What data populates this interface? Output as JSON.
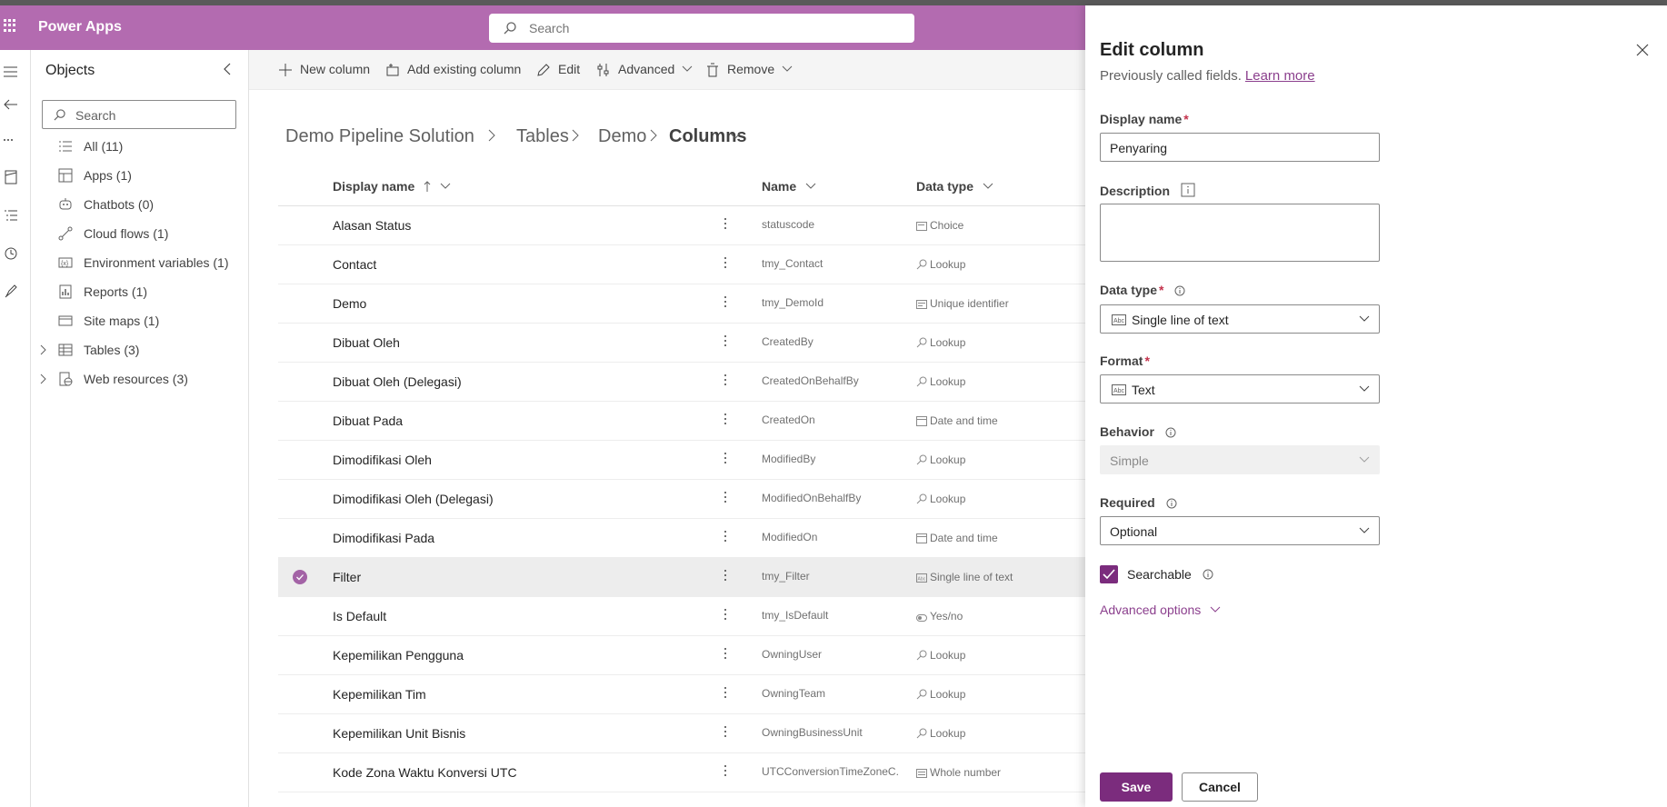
{
  "header": {
    "app_title": "Power Apps",
    "search_placeholder": "Search"
  },
  "objects_panel": {
    "title": "Objects",
    "search_placeholder": "Search",
    "items": [
      {
        "label": "All (11)",
        "icon": "list-icon",
        "expandable": false
      },
      {
        "label": "Apps (1)",
        "icon": "apps-icon",
        "expandable": false
      },
      {
        "label": "Chatbots (0)",
        "icon": "bot-icon",
        "expandable": false
      },
      {
        "label": "Cloud flows (1)",
        "icon": "flow-icon",
        "expandable": false
      },
      {
        "label": "Environment variables (1)",
        "icon": "variable-icon",
        "expandable": false
      },
      {
        "label": "Reports (1)",
        "icon": "report-icon",
        "expandable": false
      },
      {
        "label": "Site maps (1)",
        "icon": "sitemap-icon",
        "expandable": false
      },
      {
        "label": "Tables (3)",
        "icon": "table-icon",
        "expandable": true
      },
      {
        "label": "Web resources (3)",
        "icon": "web-resource-icon",
        "expandable": true
      }
    ]
  },
  "toolbar": {
    "new_column": "New column",
    "add_existing_column": "Add existing column",
    "edit": "Edit",
    "advanced": "Advanced",
    "remove": "Remove"
  },
  "breadcrumb": {
    "solution": "Demo Pipeline Solution",
    "tables": "Tables",
    "table": "Demo",
    "current": "Columns"
  },
  "grid": {
    "headers": {
      "display_name": "Display name",
      "name": "Name",
      "data_type": "Data type"
    },
    "rows": [
      {
        "display_name": "Alasan Status",
        "name": "statuscode",
        "data_type": "Choice",
        "type_icon": "choice-icon",
        "selected": false
      },
      {
        "display_name": "Contact",
        "name": "tmy_Contact",
        "data_type": "Lookup",
        "type_icon": "lookup-icon",
        "selected": false
      },
      {
        "display_name": "Demo",
        "name": "tmy_DemoId",
        "data_type": "Unique identifier",
        "type_icon": "id-icon",
        "selected": false
      },
      {
        "display_name": "Dibuat Oleh",
        "name": "CreatedBy",
        "data_type": "Lookup",
        "type_icon": "lookup-icon",
        "selected": false
      },
      {
        "display_name": "Dibuat Oleh (Delegasi)",
        "name": "CreatedOnBehalfBy",
        "data_type": "Lookup",
        "type_icon": "lookup-icon",
        "selected": false
      },
      {
        "display_name": "Dibuat Pada",
        "name": "CreatedOn",
        "data_type": "Date and time",
        "type_icon": "calendar-icon",
        "selected": false
      },
      {
        "display_name": "Dimodifikasi Oleh",
        "name": "ModifiedBy",
        "data_type": "Lookup",
        "type_icon": "lookup-icon",
        "selected": false
      },
      {
        "display_name": "Dimodifikasi Oleh (Delegasi)",
        "name": "ModifiedOnBehalfBy",
        "data_type": "Lookup",
        "type_icon": "lookup-icon",
        "selected": false
      },
      {
        "display_name": "Dimodifikasi Pada",
        "name": "ModifiedOn",
        "data_type": "Date and time",
        "type_icon": "calendar-icon",
        "selected": false
      },
      {
        "display_name": "Filter",
        "name": "tmy_Filter",
        "data_type": "Single line of text",
        "type_icon": "text-icon",
        "selected": true
      },
      {
        "display_name": "Is Default",
        "name": "tmy_IsDefault",
        "data_type": "Yes/no",
        "type_icon": "toggle-icon",
        "selected": false
      },
      {
        "display_name": "Kepemilikan Pengguna",
        "name": "OwningUser",
        "data_type": "Lookup",
        "type_icon": "lookup-icon",
        "selected": false
      },
      {
        "display_name": "Kepemilikan Tim",
        "name": "OwningTeam",
        "data_type": "Lookup",
        "type_icon": "lookup-icon",
        "selected": false
      },
      {
        "display_name": "Kepemilikan Unit Bisnis",
        "name": "OwningBusinessUnit",
        "data_type": "Lookup",
        "type_icon": "lookup-icon",
        "selected": false
      },
      {
        "display_name": "Kode Zona Waktu Konversi UTC",
        "name": "UTCConversionTimeZoneC...",
        "data_type": "Whole number",
        "type_icon": "number-icon",
        "selected": false
      }
    ]
  },
  "edit_panel": {
    "title": "Edit column",
    "subtitle": "Previously called fields.",
    "learn_more": "Learn more",
    "display_name_label": "Display name",
    "display_name_value": "Penyaring",
    "description_label": "Description",
    "data_type_label": "Data type",
    "data_type_value": "Single line of text",
    "format_label": "Format",
    "format_value": "Text",
    "behavior_label": "Behavior",
    "behavior_value": "Simple",
    "required_label": "Required",
    "required_value": "Optional",
    "searchable_label": "Searchable",
    "searchable_checked": true,
    "advanced_options": "Advanced options",
    "required_marker": "*",
    "save": "Save",
    "cancel": "Cancel"
  },
  "colors": {
    "brand": "#b36bb0",
    "primary_button": "#7b2c7d",
    "link": "#8b3f8d"
  }
}
